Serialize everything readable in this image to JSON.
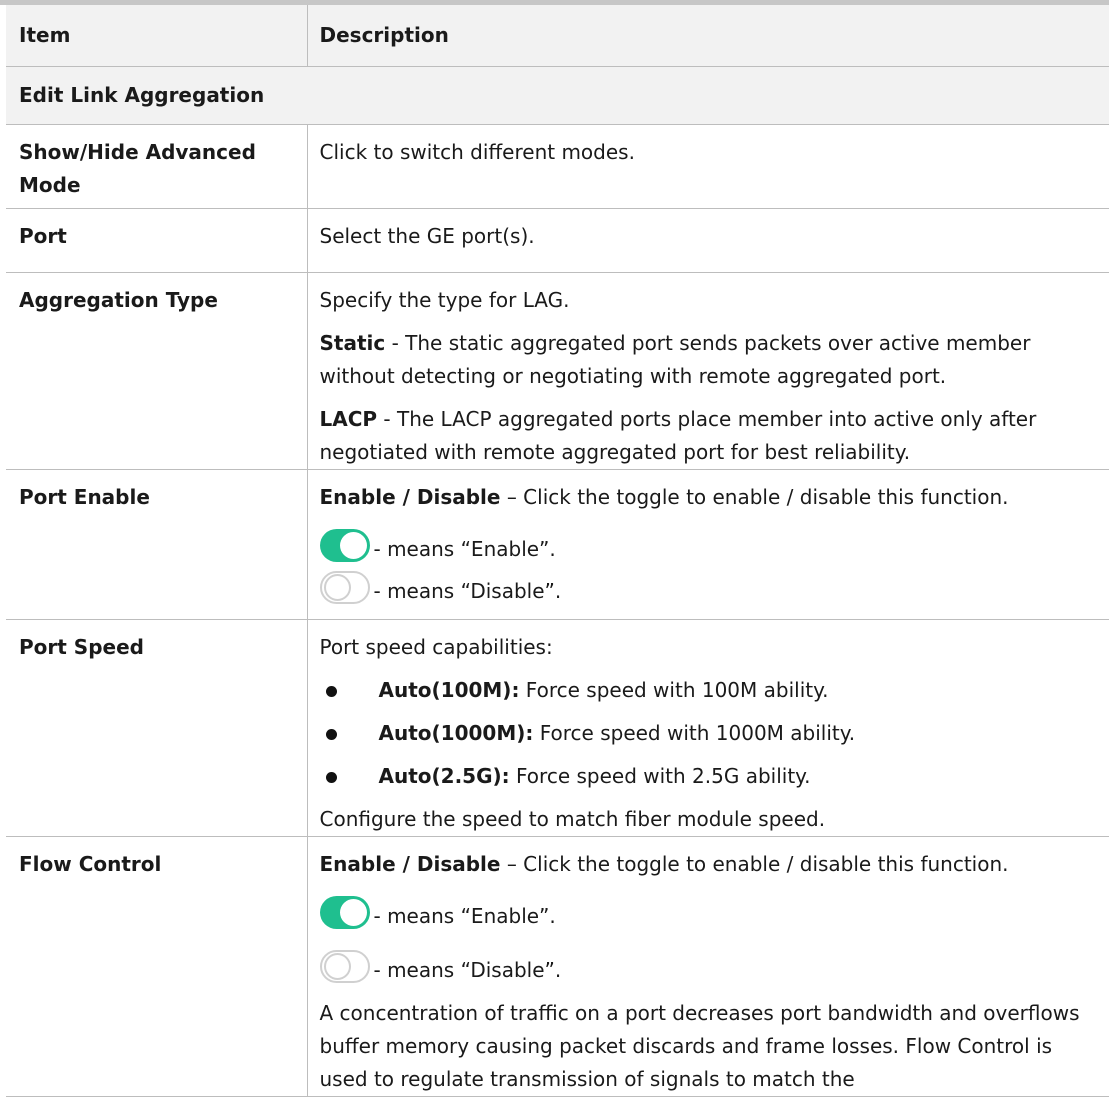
{
  "header": {
    "item": "Item",
    "description": "Description"
  },
  "section_title": "Edit Link Aggregation",
  "rows": {
    "advanced": {
      "item": "Show/Hide Advanced Mode",
      "desc": "Click to switch different modes."
    },
    "port": {
      "item": "Port",
      "desc": "Select the GE port(s)."
    },
    "aggregation": {
      "item": "Aggregation Type",
      "intro": "Specify the type for LAG.",
      "static_label": "Static",
      "static_text": " - The static aggregated port sends packets over active member without detecting or negotiating with remote aggregated port.",
      "lacp_label": "LACP",
      "lacp_text": " - The LACP aggregated ports place member into active only after negotiated with remote aggregated port for best reliability."
    },
    "port_enable": {
      "item": "Port Enable",
      "label": "Enable / Disable",
      "text": " – Click the toggle to enable / disable this function.",
      "on_text": "- means “Enable”.",
      "off_text": "- means “Disable”."
    },
    "port_speed": {
      "item": "Port Speed",
      "intro": "Port speed capabilities:",
      "bullets": [
        {
          "label": "Auto(100M):",
          "text": " Force speed with 100M ability."
        },
        {
          "label": "Auto(1000M):",
          "text": " Force speed with 1000M ability."
        },
        {
          "label": "Auto(2.5G):",
          "text": " Force speed with 2.5G ability."
        }
      ],
      "outro": "Configure the speed to match fiber module speed."
    },
    "flow_control": {
      "item": "Flow Control",
      "label": "Enable / Disable",
      "text": " – Click the toggle to enable / disable this function.",
      "on_text": "- means “Enable”.",
      "off_text": "- means “Disable”.",
      "para": "A concentration of traffic on a port decreases port bandwidth and overflows buffer memory causing packet discards and frame losses. Flow Control is used to regulate transmission of signals to match the"
    }
  },
  "colors": {
    "toggle_on": "#1fbf8f",
    "header_bg": "#f2f2f2",
    "border": "#bdbdbd"
  }
}
